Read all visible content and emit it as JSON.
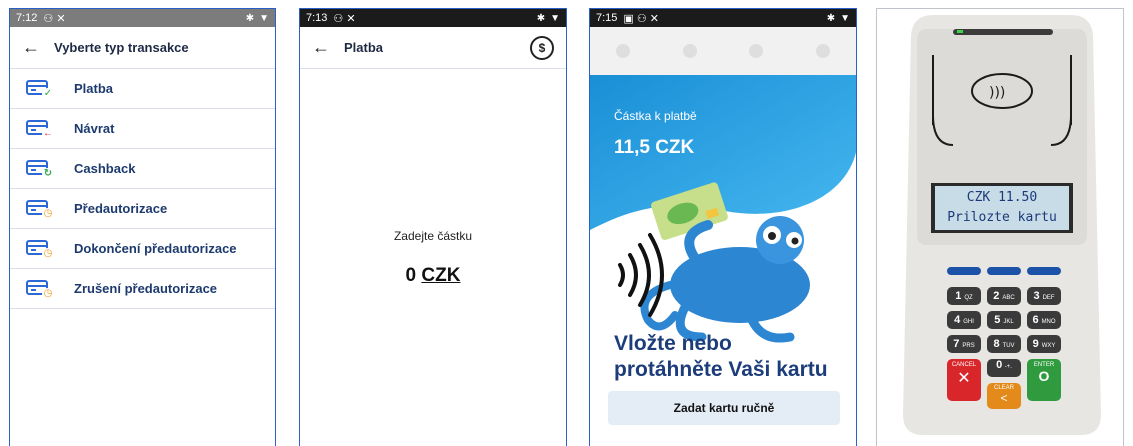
{
  "panel1": {
    "status_time": "7:12",
    "title": "Vyberte typ transakce",
    "items": [
      {
        "label": "Platba",
        "icon": "card-check-icon",
        "badge": "✓",
        "badge_color": "#2fa84f"
      },
      {
        "label": "Návrat",
        "icon": "card-return-icon",
        "badge": "←",
        "badge_color": "#e0262b"
      },
      {
        "label": "Cashback",
        "icon": "card-cashback-icon",
        "badge": "↻",
        "badge_color": "#2fa84f"
      },
      {
        "label": "Předautorizace",
        "icon": "card-clock-icon",
        "badge": "◷",
        "badge_color": "#f19a1a"
      },
      {
        "label": "Dokončení předautorizace",
        "icon": "card-clock-icon",
        "badge": "◷",
        "badge_color": "#f19a1a"
      },
      {
        "label": "Zrušení předautorizace",
        "icon": "card-clock-icon",
        "badge": "◷",
        "badge_color": "#f19a1a"
      }
    ]
  },
  "panel2": {
    "status_time": "7:13",
    "title": "Platba",
    "prompt": "Zadejte částku",
    "amount": "0",
    "currency": "CZK"
  },
  "panel3": {
    "status_time": "7:15",
    "amount_label": "Částka k platbě",
    "amount": "11,5 CZK",
    "headline_line1": "Vložte nebo",
    "headline_line2": "protáhněte Vaši kartu",
    "manual_button": "Zadat kartu ručně"
  },
  "panel4": {
    "display_line1": "CZK 11.50",
    "display_line2": "Prilozte kartu",
    "keys": [
      {
        "digit": "1",
        "sub": "QZ"
      },
      {
        "digit": "2",
        "sub": "ABC"
      },
      {
        "digit": "3",
        "sub": "DEF"
      },
      {
        "digit": "4",
        "sub": "GHI"
      },
      {
        "digit": "5",
        "sub": "JKL"
      },
      {
        "digit": "6",
        "sub": "MNO"
      },
      {
        "digit": "7",
        "sub": "PRS"
      },
      {
        "digit": "8",
        "sub": "TUV"
      },
      {
        "digit": "9",
        "sub": "WXY"
      }
    ],
    "zero_key": "0",
    "zero_sub": "-+.",
    "cancel_label": "CANCEL",
    "cancel_symbol": "✕",
    "clear_label": "CLEAR",
    "clear_symbol": "<",
    "enter_label": "ENTER",
    "enter_symbol": "O"
  }
}
